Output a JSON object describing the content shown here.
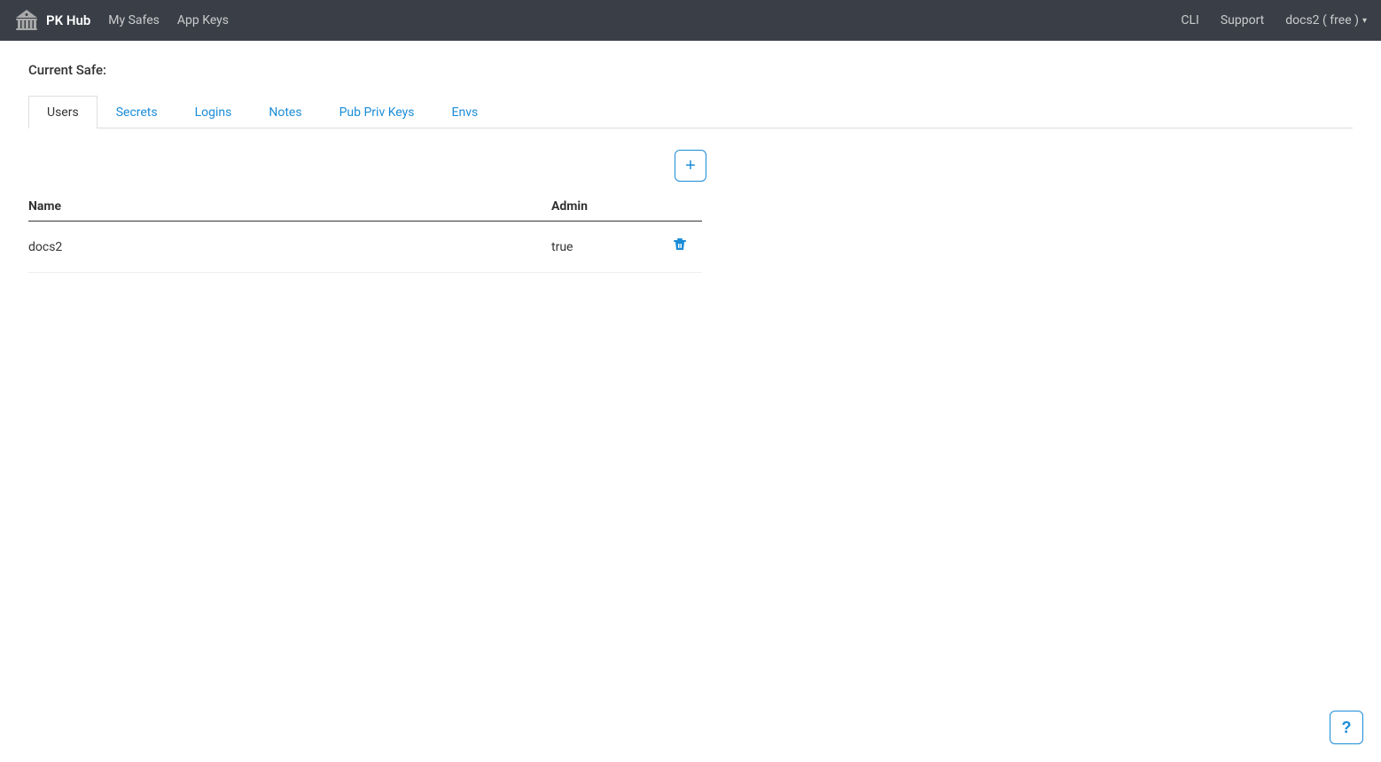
{
  "navbar": {
    "brand": "PK Hub",
    "my_safes": "My Safes",
    "app_keys": "App Keys",
    "cli": "CLI",
    "support": "Support",
    "user": "docs2 ( free )",
    "chevron": "▾"
  },
  "page": {
    "current_safe_label": "Current Safe:"
  },
  "tabs": [
    {
      "id": "users",
      "label": "Users",
      "active": true
    },
    {
      "id": "secrets",
      "label": "Secrets",
      "active": false
    },
    {
      "id": "logins",
      "label": "Logins",
      "active": false
    },
    {
      "id": "notes",
      "label": "Notes",
      "active": false
    },
    {
      "id": "pub-priv-keys",
      "label": "Pub Priv Keys",
      "active": false
    },
    {
      "id": "envs",
      "label": "Envs",
      "active": false
    }
  ],
  "add_button_label": "+",
  "table": {
    "col_name": "Name",
    "col_admin": "Admin",
    "rows": [
      {
        "name": "docs2",
        "admin": "true"
      }
    ]
  },
  "help_icon": "?"
}
